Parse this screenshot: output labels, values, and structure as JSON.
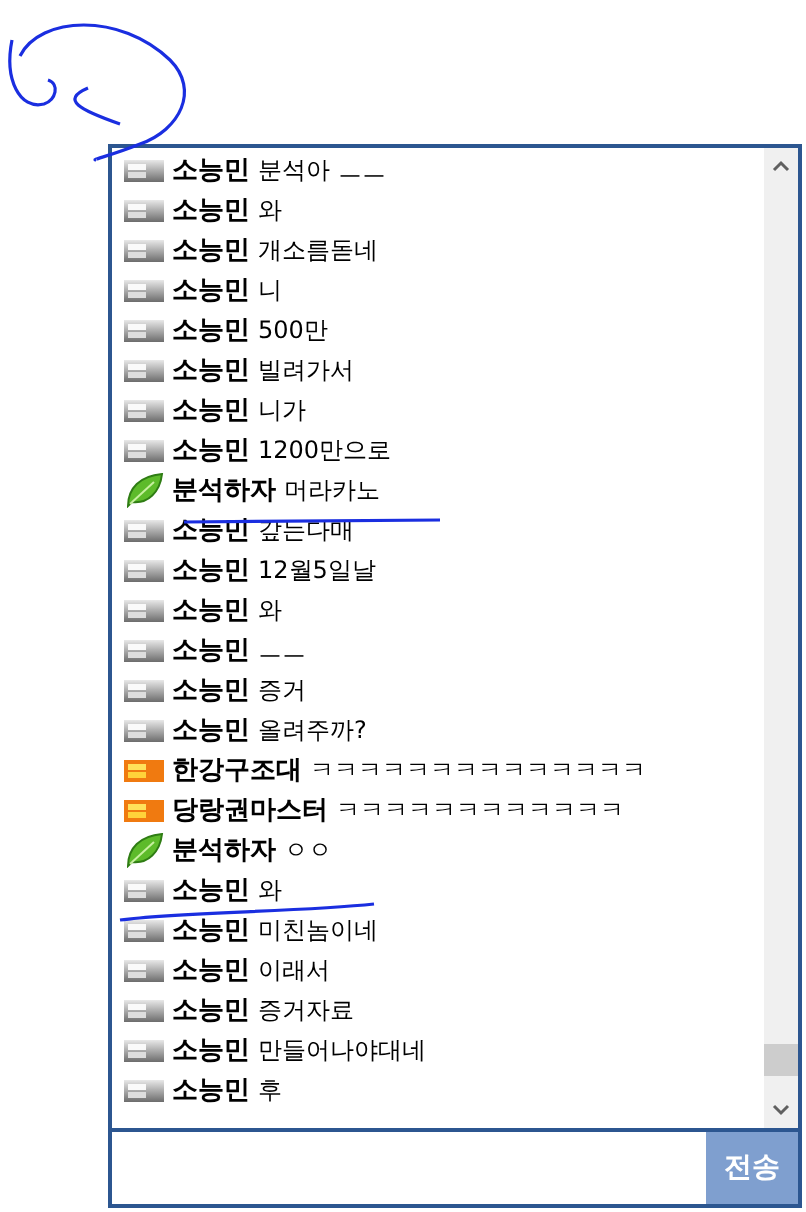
{
  "messages": [
    {
      "kind": "gray",
      "sender": "소능민",
      "text": "분석아 ㅡㅡ"
    },
    {
      "kind": "gray",
      "sender": "소능민",
      "text": "와"
    },
    {
      "kind": "gray",
      "sender": "소능민",
      "text": "개소름돋네"
    },
    {
      "kind": "gray",
      "sender": "소능민",
      "text": "니"
    },
    {
      "kind": "gray",
      "sender": "소능민",
      "text": "500만"
    },
    {
      "kind": "gray",
      "sender": "소능민",
      "text": "빌려가서"
    },
    {
      "kind": "gray",
      "sender": "소능민",
      "text": "니가"
    },
    {
      "kind": "gray",
      "sender": "소능민",
      "text": "1200만으로"
    },
    {
      "kind": "leaf",
      "sender": "분석하자",
      "text": "머라카노"
    },
    {
      "kind": "gray",
      "sender": "소능민",
      "text": "갚는다매"
    },
    {
      "kind": "gray",
      "sender": "소능민",
      "text": "12월5일날"
    },
    {
      "kind": "gray",
      "sender": "소능민",
      "text": "와"
    },
    {
      "kind": "gray",
      "sender": "소능민",
      "text": "ㅡㅡ"
    },
    {
      "kind": "gray",
      "sender": "소능민",
      "text": "증거"
    },
    {
      "kind": "gray",
      "sender": "소능민",
      "text": "올려주까?"
    },
    {
      "kind": "orange",
      "sender": "한강구조대",
      "text": "ㅋㅋㅋㅋㅋㅋㅋㅋㅋㅋㅋㅋㅋㅋ"
    },
    {
      "kind": "orange",
      "sender": "당랑권마스터",
      "text": "ㅋㅋㅋㅋㅋㅋㅋㅋㅋㅋㅋㅋ"
    },
    {
      "kind": "leaf",
      "sender": "분석하자",
      "text": "ㅇㅇ"
    },
    {
      "kind": "gray",
      "sender": "소능민",
      "text": "와"
    },
    {
      "kind": "gray",
      "sender": "소능민",
      "text": "미친놈이네"
    },
    {
      "kind": "gray",
      "sender": "소능민",
      "text": "이래서"
    },
    {
      "kind": "gray",
      "sender": "소능민",
      "text": "증거자료"
    },
    {
      "kind": "gray",
      "sender": "소능민",
      "text": "만들어나야대네"
    },
    {
      "kind": "gray",
      "sender": "소능민",
      "text": "후"
    }
  ],
  "send_button": "전송"
}
